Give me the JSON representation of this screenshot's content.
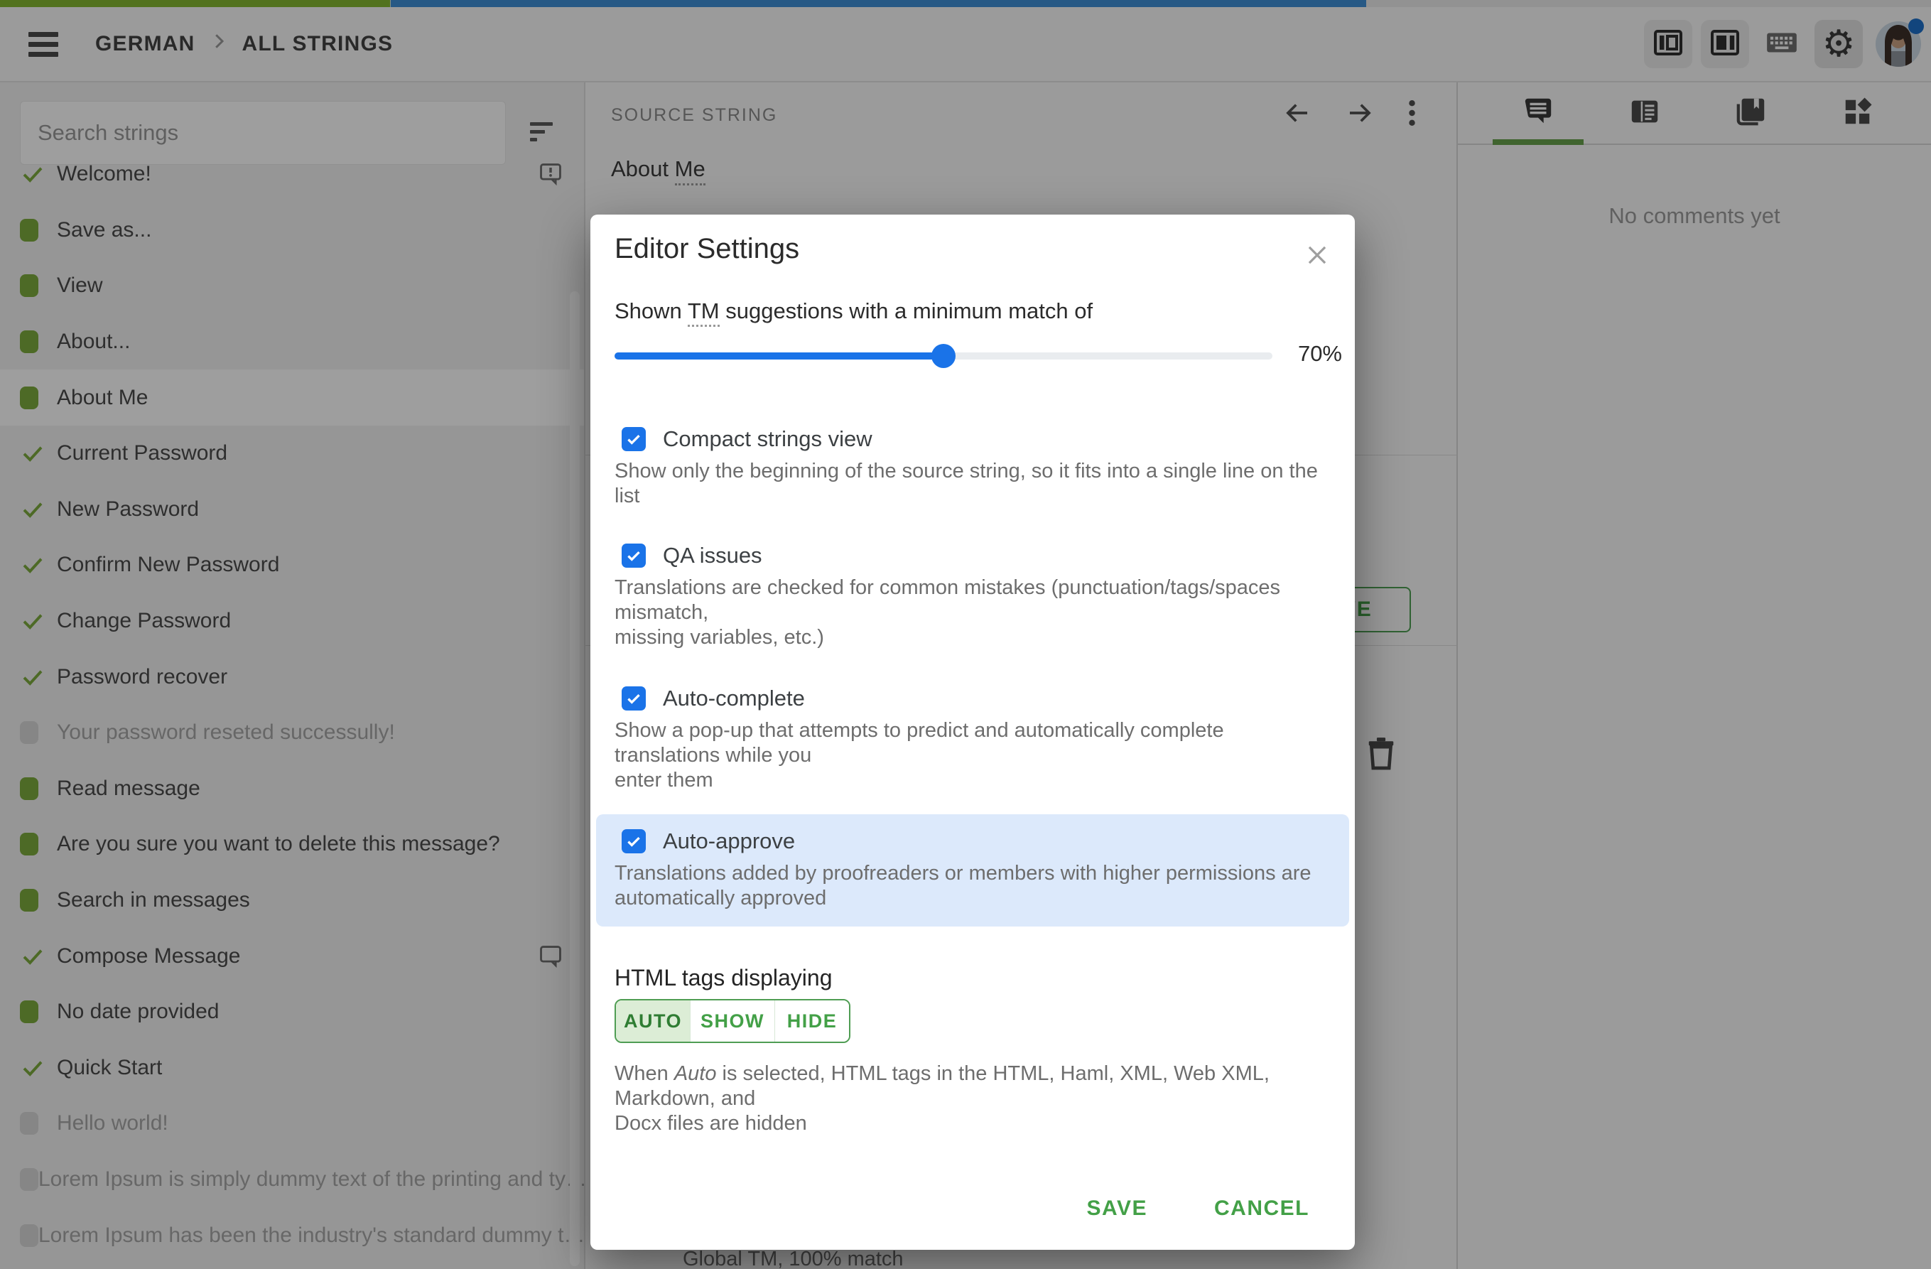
{
  "progress": {
    "approved_pct": 20.2,
    "translated_pct": 50.5,
    "approved_color": "#84b831",
    "translated_color": "#3f8fd6"
  },
  "topbar": {
    "breadcrumb": [
      "GERMAN",
      "ALL STRINGS"
    ]
  },
  "sidebar": {
    "search_placeholder": "Search strings",
    "strings": [
      {
        "label": "Welcome!",
        "status": "approved",
        "right_icon": "comment-issue"
      },
      {
        "label": "Save as...",
        "status": "translated"
      },
      {
        "label": "View",
        "status": "translated"
      },
      {
        "label": "About...",
        "status": "translated"
      },
      {
        "label": "About Me",
        "status": "translated",
        "active": true
      },
      {
        "label": "Current Password",
        "status": "approved"
      },
      {
        "label": "New Password",
        "status": "approved"
      },
      {
        "label": "Confirm New Password",
        "status": "approved"
      },
      {
        "label": "Change Password",
        "status": "approved"
      },
      {
        "label": "Password recover",
        "status": "approved"
      },
      {
        "label": "Your password reseted successully!",
        "status": "untranslated"
      },
      {
        "label": "Read message",
        "status": "translated"
      },
      {
        "label": "Are you sure you want to delete this message?",
        "status": "translated"
      },
      {
        "label": "Search in messages",
        "status": "translated"
      },
      {
        "label": "Compose Message",
        "status": "approved",
        "right_icon": "comment"
      },
      {
        "label": "No date provided",
        "status": "translated"
      },
      {
        "label": "Quick Start",
        "status": "approved"
      },
      {
        "label": "Hello world!",
        "status": "untranslated"
      },
      {
        "label": "Lorem Ipsum is simply dummy text of the printing and ty…",
        "status": "untranslated"
      },
      {
        "label": "Lorem Ipsum has been the industry's standard dummy t…",
        "status": "untranslated"
      }
    ]
  },
  "main": {
    "source_label": "SOURCE STRING",
    "source_prefix": "About ",
    "source_term": "Me",
    "save_label": "SAVE",
    "tm_match": "Global TM, 100% match"
  },
  "comments_panel": {
    "empty_text": "No comments yet"
  },
  "modal": {
    "title": "Editor Settings",
    "tm_setting": {
      "label_before": "Shown ",
      "label_abbr": "TM",
      "label_after": " suggestions with a minimum match of",
      "value": "70%",
      "slider_pct": 50
    },
    "settings": [
      {
        "label": "Compact strings view",
        "checked": true,
        "desc": "Show only the beginning of the source string, so it fits into a single line on the list"
      },
      {
        "label": "QA issues",
        "checked": true,
        "desc": "Translations are checked for common mistakes (punctuation/tags/spaces mismatch,\nmissing variables, etc.)"
      },
      {
        "label": "Auto-complete",
        "checked": true,
        "desc": "Show a pop-up that attempts to predict and automatically complete translations while you\nenter them"
      },
      {
        "label": "Auto-approve",
        "checked": true,
        "highlighted": true,
        "desc": "Translations added by proofreaders or members with higher permissions are\nautomatically approved"
      }
    ],
    "html_tags": {
      "heading": "HTML tags displaying",
      "options": [
        "AUTO",
        "SHOW",
        "HIDE"
      ],
      "selected_index": 0,
      "desc_before": "When ",
      "desc_em": "Auto",
      "desc_after": " is selected, HTML tags in the HTML, Haml, XML, Web XML, Markdown, and\nDocx files are hidden"
    },
    "buttons": {
      "save": "SAVE",
      "cancel": "CANCEL"
    },
    "accent_blue": "#1a73e8",
    "accent_green": "#43a047"
  }
}
